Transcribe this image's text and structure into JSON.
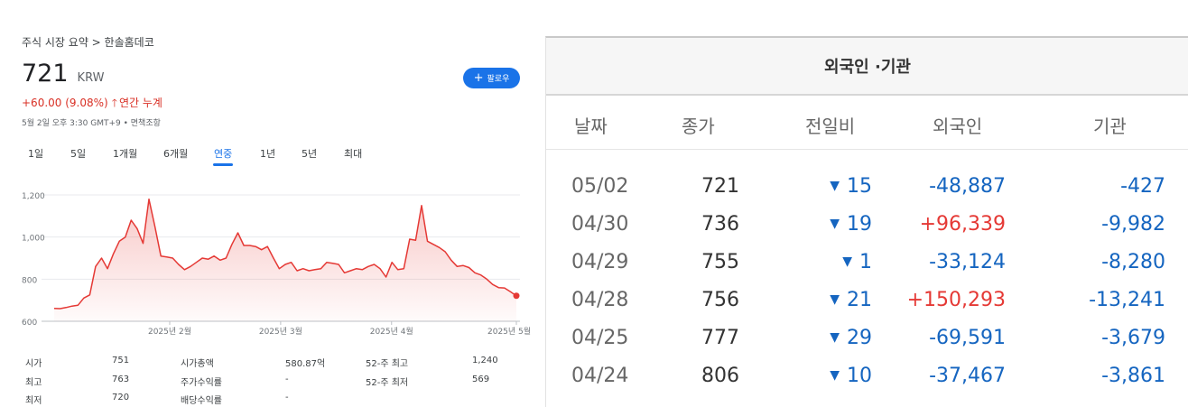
{
  "breadcrumb": "주식 시장 요약 > 한솔홈데코",
  "quote": {
    "price": "721",
    "currency": "KRW",
    "change_text": "+60.00 (9.08%)",
    "period_text": "연간 누계",
    "timestamp": "5월 2일 오후 3:30 GMT+9 • 면책조항",
    "follow_label": "팔로우"
  },
  "range_tabs": [
    {
      "label": "1일",
      "active": false
    },
    {
      "label": "5일",
      "active": false
    },
    {
      "label": "1개월",
      "active": false
    },
    {
      "label": "6개월",
      "active": false
    },
    {
      "label": "연중",
      "active": true
    },
    {
      "label": "1년",
      "active": false
    },
    {
      "label": "5년",
      "active": false
    },
    {
      "label": "최대",
      "active": false
    }
  ],
  "chart_data": {
    "type": "area",
    "color": "#e53935",
    "ylim": [
      600,
      1200
    ],
    "y_ticks": [
      "1,200",
      "1,000",
      "800",
      "600"
    ],
    "y_tick_values": [
      1200,
      1000,
      800,
      600
    ],
    "x_ticks": [
      {
        "label": "2025년 2월",
        "index": 25
      },
      {
        "label": "2025년 3월",
        "index": 49
      },
      {
        "label": "2025년 4월",
        "index": 73
      },
      {
        "label": "2025년 5월",
        "index": 100
      }
    ],
    "grid": true,
    "values": [
      661,
      660,
      665,
      672,
      676,
      710,
      725,
      860,
      900,
      850,
      920,
      980,
      1000,
      1080,
      1040,
      970,
      1180,
      1050,
      910,
      905,
      900,
      870,
      845,
      860,
      880,
      900,
      895,
      910,
      890,
      900,
      965,
      1020,
      960,
      960,
      955,
      940,
      955,
      900,
      850,
      870,
      880,
      840,
      850,
      840,
      845,
      850,
      880,
      875,
      870,
      830,
      840,
      850,
      845,
      860,
      870,
      850,
      810,
      880,
      845,
      850,
      990,
      985,
      1150,
      980,
      965,
      950,
      930,
      890,
      860,
      865,
      855,
      830,
      820,
      800,
      775,
      760,
      758,
      740,
      721
    ]
  },
  "stats": [
    {
      "label": "시가",
      "value": "751"
    },
    {
      "label": "최고",
      "value": "763"
    },
    {
      "label": "최저",
      "value": "720"
    },
    {
      "label": "시가총액",
      "value": "580.87억"
    },
    {
      "label": "주가수익률",
      "value": "-"
    },
    {
      "label": "배당수익률",
      "value": "-"
    },
    {
      "label": "52-주 최고",
      "value": "1,240"
    },
    {
      "label": "52-주 최저",
      "value": "569"
    }
  ],
  "investor_table": {
    "title": "외국인 ·기관",
    "columns": [
      "날짜",
      "종가",
      "전일비",
      "외국인",
      "기관"
    ],
    "rows": [
      {
        "date": "05/02",
        "close": "721",
        "change": "15",
        "foreign": "-48,887",
        "institution": "-427"
      },
      {
        "date": "04/30",
        "close": "736",
        "change": "19",
        "foreign": "+96,339",
        "institution": "-9,982"
      },
      {
        "date": "04/29",
        "close": "755",
        "change": "1",
        "foreign": "-33,124",
        "institution": "-8,280"
      },
      {
        "date": "04/28",
        "close": "756",
        "change": "21",
        "foreign": "+150,293",
        "institution": "-13,241"
      },
      {
        "date": "04/25",
        "close": "777",
        "change": "29",
        "foreign": "-69,591",
        "institution": "-3,679"
      },
      {
        "date": "04/24",
        "close": "806",
        "change": "10",
        "foreign": "-37,467",
        "institution": "-3,861"
      }
    ]
  }
}
